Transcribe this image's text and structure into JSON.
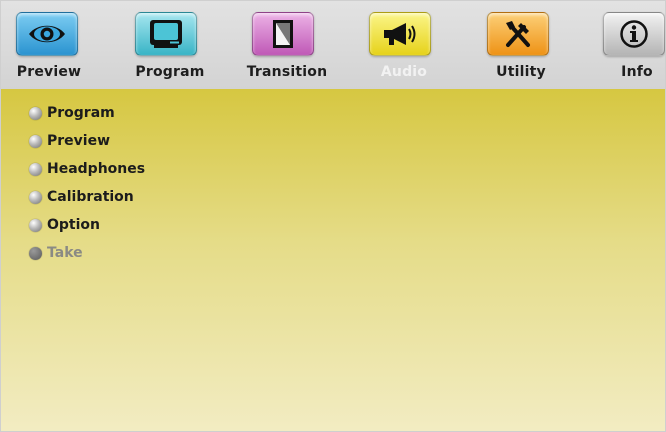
{
  "toolbar": {
    "tabs": [
      {
        "label": "Preview",
        "icon": "eye-icon",
        "color": "#3aa7e0",
        "active": false
      },
      {
        "label": "Program",
        "icon": "monitor-icon",
        "color": "#4cc4d6",
        "active": false
      },
      {
        "label": "Transition",
        "icon": "transition-icon",
        "color": "#cc6fc4",
        "active": false
      },
      {
        "label": "Audio",
        "icon": "megaphone-icon",
        "color": "#f0e020",
        "active": true
      },
      {
        "label": "Utility",
        "icon": "tools-icon",
        "color": "#f4a020",
        "active": false
      },
      {
        "label": "Info",
        "icon": "info-icon",
        "color": "#c8c8c8",
        "active": false
      }
    ]
  },
  "menu": {
    "items": [
      {
        "label": "Program",
        "enabled": true
      },
      {
        "label": "Preview",
        "enabled": true
      },
      {
        "label": "Headphones",
        "enabled": true
      },
      {
        "label": "Calibration",
        "enabled": true
      },
      {
        "label": "Option",
        "enabled": true
      },
      {
        "label": "Take",
        "enabled": false
      }
    ]
  },
  "colors": {
    "content_top": "#d6c741",
    "content_bottom": "#f2ecc2",
    "active_label": "#f2f2f2"
  }
}
